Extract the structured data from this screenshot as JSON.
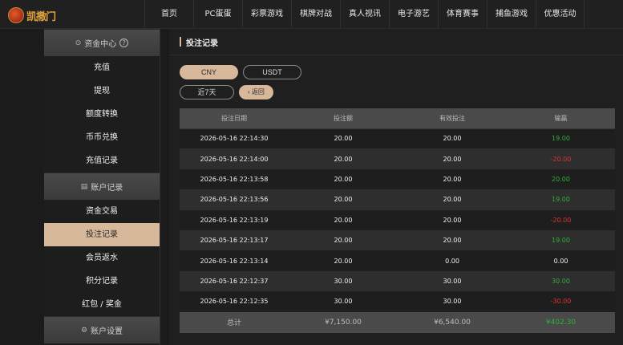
{
  "logo": {
    "text": "凯撒门"
  },
  "nav": [
    "首页",
    "PC蛋蛋",
    "彩票游戏",
    "棋牌对战",
    "真人视讯",
    "电子游艺",
    "体育赛事",
    "捕鱼游戏",
    "优惠活动"
  ],
  "sidebar": {
    "sections": [
      {
        "title": "资金中心",
        "icon": "check-circle-icon",
        "help": "?",
        "items": [
          "充值",
          "提现",
          "额度转换",
          "币币兑换",
          "充值记录"
        ]
      },
      {
        "title": "账户记录",
        "icon": "document-icon",
        "items": [
          "资金交易",
          "投注记录",
          "会员返水",
          "积分记录",
          "红包 / 奖金"
        ]
      },
      {
        "title": "账户设置",
        "icon": "gear-card-icon",
        "items": []
      }
    ],
    "active": "投注记录"
  },
  "main": {
    "title": "投注记录",
    "currency": [
      "CNY",
      "USDT"
    ],
    "currency_selected": "CNY",
    "range": "近7天",
    "back": "返回",
    "back_icon": "chevron-left-icon"
  },
  "table": {
    "headers": [
      "投注日期",
      "投注额",
      "有效投注",
      "输赢"
    ],
    "rows": [
      {
        "date": "2026-05-16 22:14:30",
        "bet": "20.00",
        "valid": "20.00",
        "win": "19.00",
        "sign": "pos"
      },
      {
        "date": "2026-05-16 22:14:00",
        "bet": "20.00",
        "valid": "20.00",
        "win": "-20.00",
        "sign": "neg"
      },
      {
        "date": "2026-05-16 22:13:58",
        "bet": "20.00",
        "valid": "20.00",
        "win": "20.00",
        "sign": "pos"
      },
      {
        "date": "2026-05-16 22:13:56",
        "bet": "20.00",
        "valid": "20.00",
        "win": "19.00",
        "sign": "pos"
      },
      {
        "date": "2026-05-16 22:13:19",
        "bet": "20.00",
        "valid": "20.00",
        "win": "-20.00",
        "sign": "neg"
      },
      {
        "date": "2026-05-16 22:13:17",
        "bet": "20.00",
        "valid": "20.00",
        "win": "19.00",
        "sign": "pos"
      },
      {
        "date": "2026-05-16 22:13:14",
        "bet": "20.00",
        "valid": "0.00",
        "win": "0.00",
        "sign": "zero"
      },
      {
        "date": "2026-05-16 22:12:37",
        "bet": "30.00",
        "valid": "30.00",
        "win": "30.00",
        "sign": "pos"
      },
      {
        "date": "2026-05-16 22:12:35",
        "bet": "30.00",
        "valid": "30.00",
        "win": "-30.00",
        "sign": "neg"
      }
    ],
    "footer": {
      "label": "总计",
      "bet": "¥7,150.00",
      "valid": "¥6,540.00",
      "win": "¥402.30"
    }
  },
  "colors": {
    "accent": "#d8b89a",
    "positive": "#2fae3a",
    "negative": "#e03030"
  }
}
